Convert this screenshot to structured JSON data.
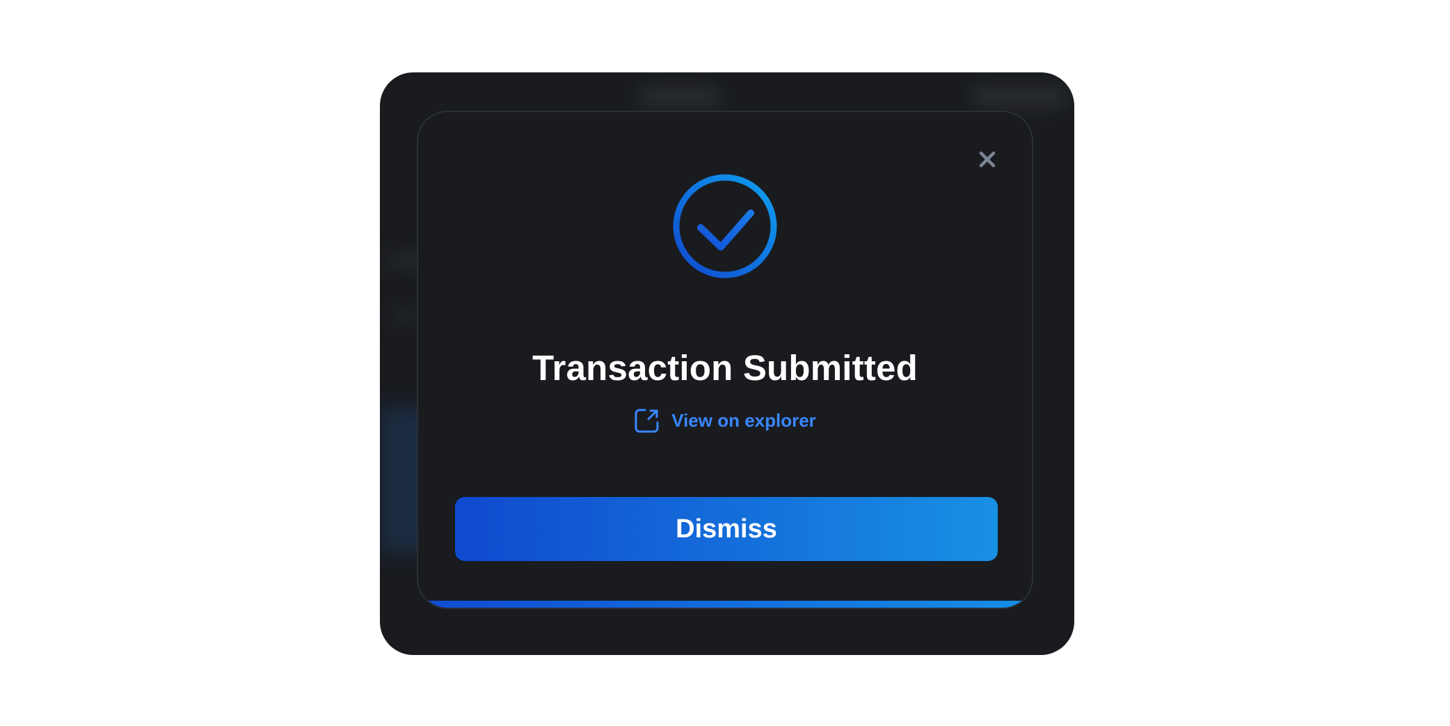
{
  "modal": {
    "title": "Transaction Submitted",
    "explorer_link_label": "View on explorer",
    "dismiss_label": "Dismiss",
    "close_icon": "close-icon",
    "success_icon": "check-circle-icon",
    "link_icon": "external-link-icon"
  },
  "colors": {
    "frame_background": "#191b1f",
    "accent_blue": "#3a87ff",
    "gradient_start": "#1049cf",
    "gradient_end": "#1890e4",
    "close_icon": "#7c8594"
  }
}
